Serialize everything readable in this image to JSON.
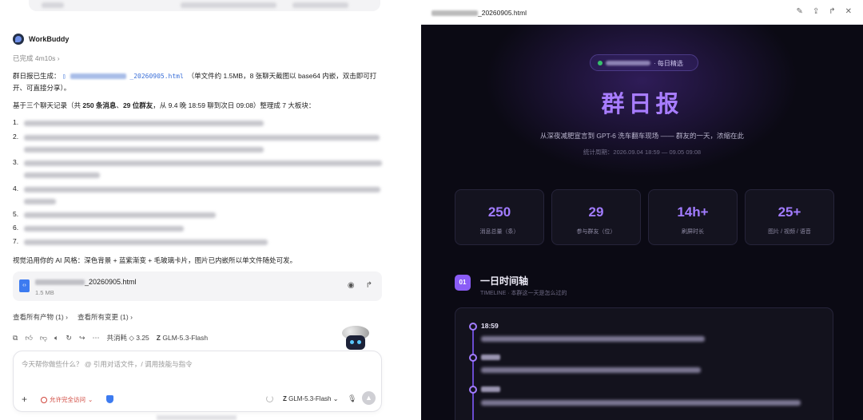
{
  "chat": {
    "bot_name": "WorkBuddy",
    "status": "已完成 4m10s",
    "status_chevron": "›",
    "report_prefix": "群日报已生成：",
    "report_filename_suffix": "_20260905.html",
    "report_note": "（单文件约 1.5MB，8 张聊天截图以 base64 内嵌，双击即可打开、可直接分享）。",
    "summary_prefix": "基于三个聊天记录（共 ",
    "summary_msgs": "250 条消息",
    "summary_sep": "、",
    "summary_members": "29 位群友",
    "summary_suffix": "，从 9.4 晚 18:59 聊到次日 09:08）整理成 7 大板块：",
    "list_numbers": [
      "1.",
      "2.",
      "3.",
      "4.",
      "5.",
      "6.",
      "7."
    ],
    "visual_note": "视觉沿用你的 AI 风格：深色背景 + 蓝紫渐变 + 毛玻璃卡片，图片已内嵌所以单文件随处可发。",
    "file_card": {
      "name_suffix": "_20260905.html",
      "size": "1.5 MB"
    },
    "links": {
      "artifacts": "查看所有产物 (1) ›",
      "changes": "查看所有变更 (1) ›"
    },
    "toolbar": {
      "cost": "共消耗 ◇ 3.25",
      "model_logo": "Z",
      "model_name": "GLM-5.3-Flash"
    },
    "input": {
      "placeholder": "今天帮你做些什么？ @ 引用对话文件，/ 调用技能与指令",
      "plus": "+",
      "access": "允许完全访问",
      "access_caret": "⌄",
      "model_logo": "Z",
      "model_name": "GLM-5.3-Flash ⌄",
      "send_icon": "▲"
    }
  },
  "preview": {
    "title_suffix": "_20260905.html",
    "pill_text": "· 每日精选",
    "big_title": "群日报",
    "subtitle": "从深夜减肥宣言到 GPT-6 洗车翻车现场 —— 群友的一天，浓缩在此",
    "period": "统计周期：2026.09.04 18:59 — 09.05 09:08",
    "stats": [
      {
        "value": "250",
        "label": "消息总量（条）"
      },
      {
        "value": "29",
        "label": "参与群友（位）"
      },
      {
        "value": "14h+",
        "label": "刷屏时长"
      },
      {
        "value": "25+",
        "label": "图片 / 视频 / 语音"
      }
    ],
    "section": {
      "badge": "01",
      "title": "一日时间轴",
      "subtitle": "TIMELINE · 本群这一天是怎么过的"
    },
    "timeline_first_time": "18:59"
  },
  "colors": {
    "accent_purple": "#a87dff",
    "link_blue": "#3a6fd8",
    "warning_red": "#d0463c"
  }
}
